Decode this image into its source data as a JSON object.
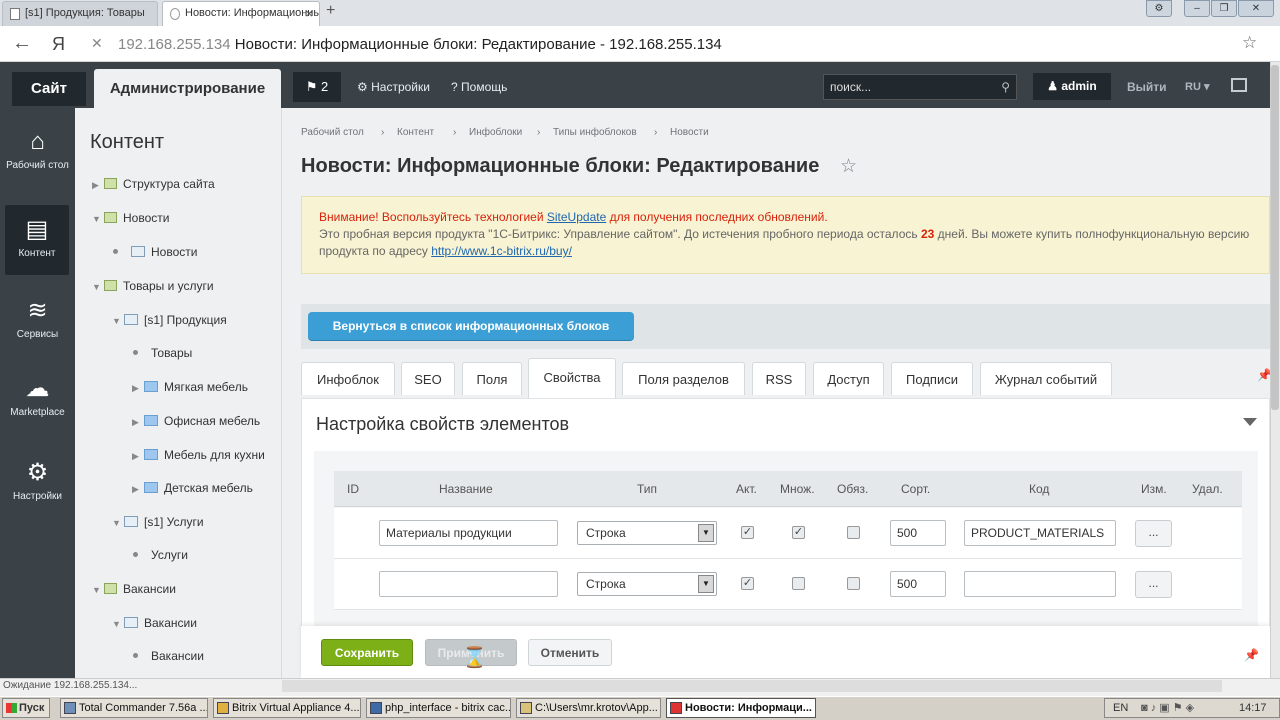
{
  "browser": {
    "tabs": [
      {
        "label": "[s1] Продукция: Товары"
      },
      {
        "label": "Новости: Информационные блоки"
      }
    ],
    "new_tab": "+",
    "back": "←",
    "logo": "Я",
    "stop": "✕",
    "address_host": "192.168.255.134",
    "address_title": "Новости: Информационные блоки: Редактирование - 192.168.255.134",
    "bookmark": "☆",
    "window_buttons": [
      "⚙",
      "‒",
      "❐",
      "✕"
    ]
  },
  "admin_panel": {
    "site": "Сайт",
    "admin": "Администрирование",
    "notifications": "2",
    "settings": "Настройки",
    "help": "Помощь",
    "search_placeholder": "поиск...",
    "user": "admin",
    "logout": "Выйти",
    "lang": "RU"
  },
  "left_menu": [
    {
      "label": "Рабочий стол",
      "icon": "home-icon",
      "glyph": "⌂"
    },
    {
      "label": "Контент",
      "icon": "document-icon",
      "glyph": "▤"
    },
    {
      "label": "Сервисы",
      "icon": "layers-icon",
      "glyph": "≋"
    },
    {
      "label": "Marketplace",
      "icon": "cloud-download-icon",
      "glyph": "☁"
    },
    {
      "label": "Настройки",
      "icon": "gear-icon",
      "glyph": "⚙"
    }
  ],
  "tree": {
    "title": "Контент",
    "items": [
      {
        "label": "Структура сайта"
      },
      {
        "label": "Новости"
      },
      {
        "label": "Новости"
      },
      {
        "label": "Товары и услуги"
      },
      {
        "label": "[s1] Продукция"
      },
      {
        "label": "Товары"
      },
      {
        "label": "Мягкая мебель"
      },
      {
        "label": "Офисная мебель"
      },
      {
        "label": "Мебель для кухни"
      },
      {
        "label": "Детская мебель"
      },
      {
        "label": "[s1] Услуги"
      },
      {
        "label": "Услуги"
      },
      {
        "label": "Вакансии"
      },
      {
        "label": "Вакансии"
      },
      {
        "label": "Вакансии"
      }
    ]
  },
  "breadcrumbs": [
    "Рабочий стол",
    "Контент",
    "Инфоблоки",
    "Типы инфоблоков",
    "Новости"
  ],
  "page_title": "Новости: Информационные блоки: Редактирование",
  "notice": {
    "warning_start": "Внимание! Воспользуйтесь технологией ",
    "warning_link": "SiteUpdate",
    "warning_end": " для получения последних обновлений.",
    "trial_start": "Это пробная версия продукта \"1С-Битрикс: Управление сайтом\". До истечения пробного периода осталось ",
    "days": "23",
    "trial_end": " дней. Вы можете купить полнофункциональную версию продукта по адресу ",
    "buy_link": "http://www.1c-bitrix.ru/buy/"
  },
  "back_button": "Вернуться в список информационных блоков",
  "edit_tabs": [
    "Инфоблок",
    "SEO",
    "Поля",
    "Свойства",
    "Поля разделов",
    "RSS",
    "Доступ",
    "Подписи",
    "Журнал событий"
  ],
  "active_tab": "Свойства",
  "section_title": "Настройка свойств элементов",
  "table": {
    "columns": [
      "ID",
      "Название",
      "Тип",
      "Акт.",
      "Множ.",
      "Обяз.",
      "Сорт.",
      "Код",
      "Изм.",
      "Удал."
    ],
    "rows": [
      {
        "name": "Материалы продукции",
        "type": "Строка",
        "active": true,
        "multiple": true,
        "required": false,
        "sort": "500",
        "code": "PRODUCT_MATERIALS",
        "edit": "..."
      },
      {
        "name": "",
        "type": "Строка",
        "active": true,
        "multiple": false,
        "required": false,
        "sort": "500",
        "code": "",
        "edit": "..."
      }
    ]
  },
  "footer_buttons": {
    "save": "Сохранить",
    "apply": "Применить",
    "cancel": "Отменить"
  },
  "status_bar": "Ожидание 192.168.255.134...",
  "taskbar": {
    "start": "Пуск",
    "tasks": [
      "Total Commander 7.56a ...",
      "Bitrix Virtual Appliance 4....",
      "php_interface - bitrix cac...",
      "C:\\Users\\mr.krotov\\App...",
      "Новости: Информаци..."
    ],
    "lang": "EN",
    "time": "14:17"
  }
}
